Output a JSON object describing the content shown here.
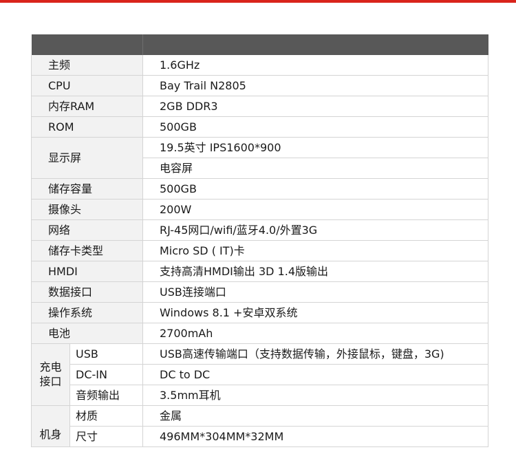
{
  "spec_table": {
    "rows": [
      {
        "label": "主频",
        "value": "1.6GHz"
      },
      {
        "label": "CPU",
        "value": "Bay Trail N2805"
      },
      {
        "label": "内存RAM",
        "value": "2GB DDR3"
      },
      {
        "label": "ROM",
        "value": "500GB"
      },
      {
        "label": "显示屏",
        "values": [
          "19.5英寸 IPS1600*900",
          "电容屏"
        ]
      },
      {
        "label": "储存容量",
        "value": "500GB"
      },
      {
        "label": "摄像头",
        "value": "200W"
      },
      {
        "label": "网络",
        "value": "RJ-45网口/wifi/蓝牙4.0/外置3G"
      },
      {
        "label": "储存卡类型",
        "value": "Micro SD ( IT)卡"
      },
      {
        "label": "HMDI",
        "value": "支持高清HMDI输出 3D 1.4版输出"
      },
      {
        "label": "数据接口",
        "value": "USB连接端口"
      },
      {
        "label": "操作系统",
        "value": "Windows 8.1 +安卓双系统"
      },
      {
        "label": "电池",
        "value": "2700mAh"
      }
    ],
    "charging_group": {
      "label_line1": "充电",
      "label_line2": "接口",
      "items": [
        {
          "label": "USB",
          "value": "USB高速传输端口（支持数据传输，外接鼠标，键盘，3G)"
        },
        {
          "label": "DC-IN",
          "value": "DC to DC"
        },
        {
          "label": "音频输出",
          "value": "3.5mm耳机"
        }
      ]
    },
    "body_group": {
      "label": "机身",
      "items": [
        {
          "label": "材质",
          "value": "金属"
        },
        {
          "label": "尺寸",
          "value": "496MM*304MM*32MM"
        }
      ]
    }
  }
}
